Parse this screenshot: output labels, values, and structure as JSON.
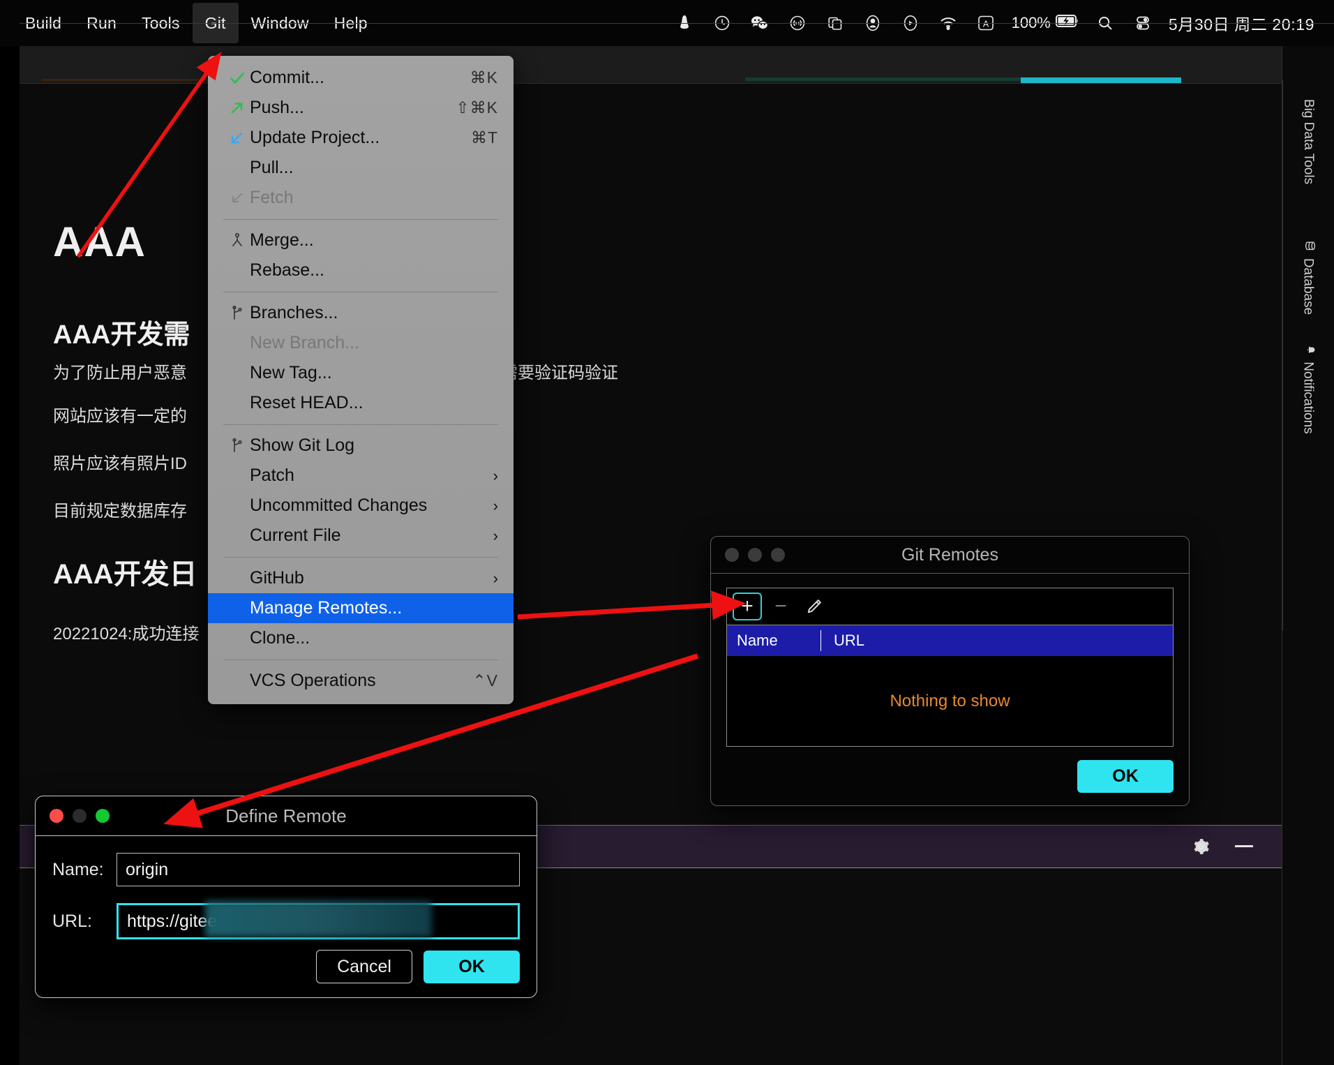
{
  "menubar": {
    "items": [
      {
        "label": "Build",
        "active": false
      },
      {
        "label": "Run",
        "active": false
      },
      {
        "label": "Tools",
        "active": false
      },
      {
        "label": "Git",
        "active": true
      },
      {
        "label": "Window",
        "active": false
      },
      {
        "label": "Help",
        "active": false
      }
    ],
    "status_icons": [
      "bell-icon",
      "time-machine-icon",
      "wechat-icon",
      "airdrop-icon",
      "screen-mirroring-icon",
      "user-account-icon",
      "playback-icon",
      "wifi-icon",
      "input-source-icon"
    ],
    "battery_percent": "100%",
    "battery_icon": "battery-charging-icon",
    "search_icon": "spotlight-search-icon",
    "control_center_icon": "control-center-icon",
    "clock": "5月30日 周二  20:19"
  },
  "git_menu": {
    "groups": [
      {
        "items": [
          {
            "label": "Commit...",
            "icon": "checkmark-icon",
            "shortcut": "⌘K",
            "disabled": false,
            "selected": false,
            "submenu": false
          },
          {
            "label": "Push...",
            "icon": "arrow-up-right-icon",
            "shortcut": "⇧⌘K",
            "disabled": false,
            "selected": false,
            "submenu": false
          },
          {
            "label": "Update Project...",
            "icon": "arrow-down-left-icon",
            "shortcut": "⌘T",
            "disabled": false,
            "selected": false,
            "submenu": false
          },
          {
            "label": "Pull...",
            "icon": "",
            "shortcut": "",
            "disabled": false,
            "selected": false,
            "submenu": false
          },
          {
            "label": "Fetch",
            "icon": "arrow-down-left-outline-icon",
            "shortcut": "",
            "disabled": true,
            "selected": false,
            "submenu": false
          }
        ]
      },
      {
        "items": [
          {
            "label": "Merge...",
            "icon": "merge-icon",
            "shortcut": "",
            "disabled": false,
            "selected": false,
            "submenu": false
          },
          {
            "label": "Rebase...",
            "icon": "",
            "shortcut": "",
            "disabled": false,
            "selected": false,
            "submenu": false
          }
        ]
      },
      {
        "items": [
          {
            "label": "Branches...",
            "icon": "branch-icon",
            "shortcut": "",
            "disabled": false,
            "selected": false,
            "submenu": false
          },
          {
            "label": "New Branch...",
            "icon": "",
            "shortcut": "",
            "disabled": true,
            "selected": false,
            "submenu": false
          },
          {
            "label": "New Tag...",
            "icon": "",
            "shortcut": "",
            "disabled": false,
            "selected": false,
            "submenu": false
          },
          {
            "label": "Reset HEAD...",
            "icon": "",
            "shortcut": "",
            "disabled": false,
            "selected": false,
            "submenu": false
          }
        ]
      },
      {
        "items": [
          {
            "label": "Show Git Log",
            "icon": "branch-icon",
            "shortcut": "",
            "disabled": false,
            "selected": false,
            "submenu": false
          },
          {
            "label": "Patch",
            "icon": "",
            "shortcut": "",
            "disabled": false,
            "selected": false,
            "submenu": true
          },
          {
            "label": "Uncommitted Changes",
            "icon": "",
            "shortcut": "",
            "disabled": false,
            "selected": false,
            "submenu": true
          },
          {
            "label": "Current File",
            "icon": "",
            "shortcut": "",
            "disabled": false,
            "selected": false,
            "submenu": true
          }
        ]
      },
      {
        "items": [
          {
            "label": "GitHub",
            "icon": "",
            "shortcut": "",
            "disabled": false,
            "selected": false,
            "submenu": true
          },
          {
            "label": "Manage Remotes...",
            "icon": "",
            "shortcut": "",
            "disabled": false,
            "selected": true,
            "submenu": false
          },
          {
            "label": "Clone...",
            "icon": "",
            "shortcut": "",
            "disabled": false,
            "selected": false,
            "submenu": false
          }
        ]
      },
      {
        "items": [
          {
            "label": "VCS Operations",
            "icon": "",
            "shortcut": "⌃V",
            "disabled": false,
            "selected": false,
            "submenu": false
          }
        ]
      }
    ]
  },
  "editor": {
    "heading1": "AAA",
    "heading2": "AAA开发需",
    "paragraphs": [
      "为了防止用户恶意",
      "网站应该有一定的",
      "照片应该有照片ID",
      "目前规定数据库存"
    ],
    "clipped_text_right": "登录和上传需要验证码验证",
    "heading3": "AAA开发日",
    "log_line": "20221024:成功连接"
  },
  "right_toolwindows": [
    {
      "label": "Big Data Tools",
      "icon": ""
    },
    {
      "label": "Database",
      "icon": "database-icon"
    },
    {
      "label": "Notifications",
      "icon": "bell-icon"
    }
  ],
  "bottom_strip": {
    "settings_icon": "gear-icon",
    "minimize_icon": "minimize-icon"
  },
  "git_remotes_dialog": {
    "title": "Git Remotes",
    "toolbar": {
      "add_label": "+",
      "remove_label": "−",
      "edit_icon": "pencil-icon"
    },
    "columns": [
      "Name",
      "URL"
    ],
    "empty_message": "Nothing to show",
    "ok_label": "OK"
  },
  "define_remote_dialog": {
    "title": "Define Remote",
    "name_label": "Name:",
    "name_value": "origin",
    "url_label": "URL:",
    "url_value": "https://gitee",
    "cancel_label": "Cancel",
    "ok_label": "OK"
  },
  "colors": {
    "accent_cyan": "#2fe4ef",
    "selection_blue": "#0f62e8",
    "header_blue": "#1c1ca8",
    "warning_orange": "#e8892a",
    "annotation_red": "#ee1111"
  }
}
